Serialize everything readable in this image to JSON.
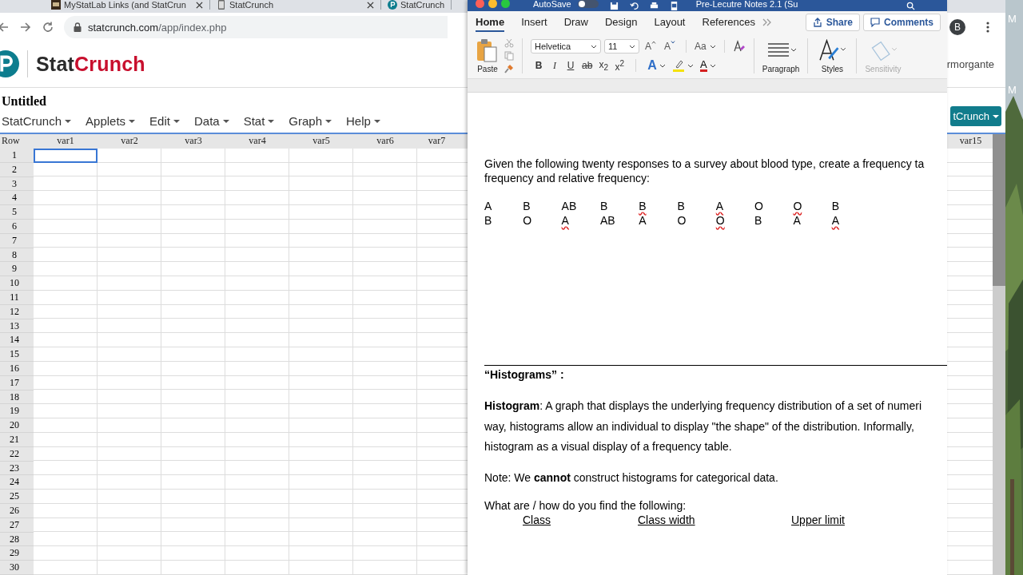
{
  "desktop": {
    "labels": [
      "M",
      "M"
    ]
  },
  "browser": {
    "tabs": [
      {
        "title": "MyStatLab Links (and StatCrun",
        "kind": "book"
      },
      {
        "title": "StatCrunch",
        "kind": "page"
      },
      {
        "title": "StatCrunch",
        "kind": "logo"
      }
    ],
    "url": {
      "host": "statcrunch.com",
      "path": "/app/index.php"
    },
    "account_initial": "B"
  },
  "statcrunch": {
    "brand": [
      "Stat",
      "Crunch"
    ],
    "username": "rmorgante",
    "document_title": "Untitled",
    "menu": [
      "StatCrunch",
      "Applets",
      "Edit",
      "Data",
      "Stat",
      "Graph",
      "Help"
    ],
    "account_button": "tCrunch",
    "grid": {
      "corner": "Row",
      "columns": [
        "var1",
        "var2",
        "var3",
        "var4",
        "var5",
        "var6",
        "var7"
      ],
      "far_columns": [
        "var15"
      ],
      "rows": [
        {
          "label": "1",
          "selected": true
        },
        {
          "label": "2",
          "selected": false
        },
        {
          "label": "3",
          "selected": false
        },
        {
          "label": "4",
          "selected": false
        },
        {
          "label": "5",
          "selected": false
        },
        {
          "label": "6",
          "selected": false
        },
        {
          "label": "7",
          "selected": false
        },
        {
          "label": "8",
          "selected": false
        },
        {
          "label": "9",
          "selected": false
        },
        {
          "label": "10",
          "selected": false
        },
        {
          "label": "11",
          "selected": false
        },
        {
          "label": "12",
          "selected": false
        },
        {
          "label": "13",
          "selected": false
        },
        {
          "label": "14",
          "selected": false
        },
        {
          "label": "15",
          "selected": false
        },
        {
          "label": "16",
          "selected": false
        },
        {
          "label": "17",
          "selected": false
        },
        {
          "label": "18",
          "selected": false
        },
        {
          "label": "19",
          "selected": false
        },
        {
          "label": "20",
          "selected": false
        },
        {
          "label": "21",
          "selected": false
        },
        {
          "label": "22",
          "selected": false
        },
        {
          "label": "23",
          "selected": false
        },
        {
          "label": "24",
          "selected": false
        },
        {
          "label": "25",
          "selected": false
        },
        {
          "label": "26",
          "selected": false
        },
        {
          "label": "27",
          "selected": false
        },
        {
          "label": "28",
          "selected": false
        },
        {
          "label": "29",
          "selected": false
        },
        {
          "label": "30",
          "selected": false
        }
      ]
    }
  },
  "word": {
    "autosave": "AutoSave",
    "autosave_on": false,
    "title": "Pre-Lecutre Notes 2.1 (Su",
    "tabs": [
      {
        "label": "Home",
        "selected": true
      },
      {
        "label": "Insert",
        "selected": false
      },
      {
        "label": "Draw",
        "selected": false
      },
      {
        "label": "Design",
        "selected": false
      },
      {
        "label": "Layout",
        "selected": false
      },
      {
        "label": "References",
        "selected": false
      }
    ],
    "share": "Share",
    "comments": "Comments",
    "paste": "Paste",
    "font": "Helvetica",
    "size": "11",
    "size_buttons": [
      {
        "label": "A",
        "kind": "grow"
      },
      {
        "label": "A",
        "kind": "shrink"
      }
    ],
    "case": "Aa",
    "format_buttons": [
      {
        "label": "B",
        "kind": "bold"
      },
      {
        "label": "I",
        "kind": "italic"
      },
      {
        "label": "U",
        "kind": "underline"
      },
      {
        "label": "ab",
        "kind": "strike"
      },
      {
        "label": "x$_{2}$",
        "kind": "plain"
      },
      {
        "label": "x$^{2}$",
        "kind": "plain"
      }
    ],
    "color_buttons": [
      {
        "label": "A",
        "kind": "effects",
        "color": "#2f6fc8"
      },
      {
        "kind": "highlight",
        "color": "#f4e10a"
      },
      {
        "label": "A",
        "kind": "font",
        "color": "#d42020"
      }
    ],
    "groups": [
      {
        "label": "Paragraph",
        "kind": "paragraph",
        "disabled": false
      },
      {
        "label": "Styles",
        "kind": "styles",
        "disabled": false
      },
      {
        "label": "Sensitivity",
        "kind": "sensitivity",
        "disabled": true
      }
    ],
    "document": {
      "intro_lines": [
        "Given the following twenty responses to a survey about blood type, create a frequency ta",
        "frequency and relative frequency:"
      ],
      "responses": [
        [
          {
            "value": "A",
            "flagged": false
          },
          {
            "value": "B",
            "flagged": false
          },
          {
            "value": "AB",
            "flagged": false
          },
          {
            "value": "B",
            "flagged": false
          },
          {
            "value": "B",
            "flagged": true
          },
          {
            "value": "B",
            "flagged": false
          },
          {
            "value": "A",
            "flagged": true
          },
          {
            "value": "O",
            "flagged": false
          },
          {
            "value": "O",
            "flagged": true
          },
          {
            "value": "B",
            "flagged": false
          }
        ],
        [
          {
            "value": "B",
            "flagged": false
          },
          {
            "value": "O",
            "flagged": false
          },
          {
            "value": "A",
            "flagged": true
          },
          {
            "value": "AB",
            "flagged": false
          },
          {
            "value": "A",
            "flagged": false
          },
          {
            "value": "O",
            "flagged": false
          },
          {
            "value": "O",
            "flagged": true
          },
          {
            "value": "B",
            "flagged": false
          },
          {
            "value": "A",
            "flagged": false
          },
          {
            "value": "A",
            "flagged": true
          }
        ]
      ],
      "heading": "“Histograms” :",
      "definition_lines": [
        "**Histogram**: A graph that displays the underlying frequency distribution of a set of numeri",
        "way, histograms allow an individual to display \"the shape\" of the distribution.  Informally,",
        "histogram as a visual display of a frequency table."
      ],
      "note": "Note: We **cannot** construct histograms for categorical data.",
      "question": "What are / how do you find the following:",
      "terms": [
        "Class",
        "Class width",
        "Upper limit"
      ]
    }
  }
}
